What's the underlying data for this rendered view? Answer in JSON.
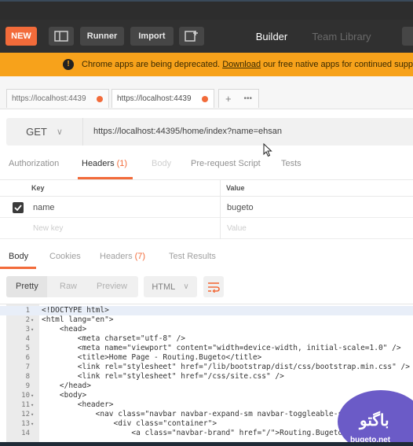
{
  "toolbar": {
    "new_label": "NEW",
    "runner_label": "Runner",
    "import_label": "Import",
    "builder_label": "Builder",
    "team_library_label": "Team Library"
  },
  "banner": {
    "message_prefix": "Chrome apps are being deprecated.",
    "link_text": "Download",
    "message_suffix": "our free native apps for continued support a"
  },
  "request_tabs": [
    {
      "label": "https://localhost:4439",
      "unsaved": true
    },
    {
      "label": "https://localhost:4439",
      "unsaved": true
    }
  ],
  "request": {
    "method": "GET",
    "url": "https://localhost:44395/home/index?name=ehsan"
  },
  "request_subtabs": {
    "authorization": "Authorization",
    "headers": "Headers",
    "headers_count": "(1)",
    "body": "Body",
    "pre_request": "Pre-request Script",
    "tests": "Tests"
  },
  "headers_table": {
    "key_header": "Key",
    "value_header": "Value",
    "rows": [
      {
        "key": "name",
        "value": "bugeto",
        "checked": true
      }
    ],
    "new_key_placeholder": "New key",
    "new_value_placeholder": "Value"
  },
  "response_tabs": {
    "body": "Body",
    "cookies": "Cookies",
    "headers": "Headers",
    "headers_count": "(7)",
    "test_results": "Test Results"
  },
  "view_modes": {
    "pretty": "Pretty",
    "raw": "Raw",
    "preview": "Preview",
    "format": "HTML"
  },
  "code_lines": [
    {
      "n": "1",
      "fold": "",
      "text": "<!DOCTYPE html>"
    },
    {
      "n": "2",
      "fold": "▾",
      "text": "<html lang=\"en\">"
    },
    {
      "n": "3",
      "fold": "▾",
      "text": "    <head>"
    },
    {
      "n": "4",
      "fold": "",
      "text": "        <meta charset=\"utf-8\" />"
    },
    {
      "n": "5",
      "fold": "",
      "text": "        <meta name=\"viewport\" content=\"width=device-width, initial-scale=1.0\" />"
    },
    {
      "n": "6",
      "fold": "",
      "text": "        <title>Home Page - Routing.Bugeto</title>"
    },
    {
      "n": "7",
      "fold": "",
      "text": "        <link rel=\"stylesheet\" href=\"/lib/bootstrap/dist/css/bootstrap.min.css\" />"
    },
    {
      "n": "8",
      "fold": "",
      "text": "        <link rel=\"stylesheet\" href=\"/css/site.css\" />"
    },
    {
      "n": "9",
      "fold": "",
      "text": "    </head>"
    },
    {
      "n": "10",
      "fold": "▾",
      "text": "    <body>"
    },
    {
      "n": "11",
      "fold": "▾",
      "text": "        <header>"
    },
    {
      "n": "12",
      "fold": "▾",
      "text": "            <nav class=\"navbar navbar-expand-sm navbar-toggleable-sm navbar-li"
    },
    {
      "n": "13",
      "fold": "▾",
      "text": "                <div class=\"container\">"
    },
    {
      "n": "14",
      "fold": "",
      "text": "                    <a class=\"navbar-brand\" href=\"/\">Routing.Bugeto</a>"
    }
  ],
  "watermark": {
    "text": "باگتو",
    "sub": "bugeto.net"
  }
}
